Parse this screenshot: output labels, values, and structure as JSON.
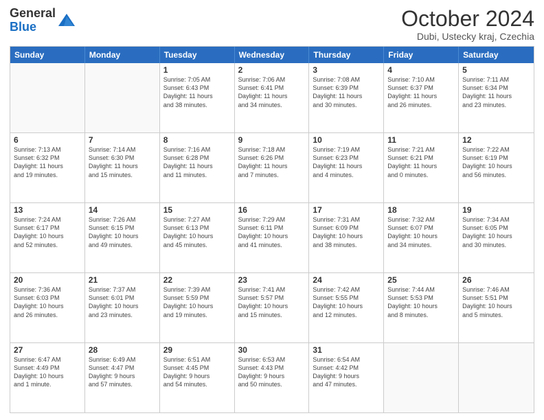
{
  "header": {
    "logo_general": "General",
    "logo_blue": "Blue",
    "month_title": "October 2024",
    "subtitle": "Dubi, Ustecky kraj, Czechia"
  },
  "weekdays": [
    "Sunday",
    "Monday",
    "Tuesday",
    "Wednesday",
    "Thursday",
    "Friday",
    "Saturday"
  ],
  "rows": [
    [
      {
        "day": "",
        "lines": []
      },
      {
        "day": "",
        "lines": []
      },
      {
        "day": "1",
        "lines": [
          "Sunrise: 7:05 AM",
          "Sunset: 6:43 PM",
          "Daylight: 11 hours",
          "and 38 minutes."
        ]
      },
      {
        "day": "2",
        "lines": [
          "Sunrise: 7:06 AM",
          "Sunset: 6:41 PM",
          "Daylight: 11 hours",
          "and 34 minutes."
        ]
      },
      {
        "day": "3",
        "lines": [
          "Sunrise: 7:08 AM",
          "Sunset: 6:39 PM",
          "Daylight: 11 hours",
          "and 30 minutes."
        ]
      },
      {
        "day": "4",
        "lines": [
          "Sunrise: 7:10 AM",
          "Sunset: 6:37 PM",
          "Daylight: 11 hours",
          "and 26 minutes."
        ]
      },
      {
        "day": "5",
        "lines": [
          "Sunrise: 7:11 AM",
          "Sunset: 6:34 PM",
          "Daylight: 11 hours",
          "and 23 minutes."
        ]
      }
    ],
    [
      {
        "day": "6",
        "lines": [
          "Sunrise: 7:13 AM",
          "Sunset: 6:32 PM",
          "Daylight: 11 hours",
          "and 19 minutes."
        ]
      },
      {
        "day": "7",
        "lines": [
          "Sunrise: 7:14 AM",
          "Sunset: 6:30 PM",
          "Daylight: 11 hours",
          "and 15 minutes."
        ]
      },
      {
        "day": "8",
        "lines": [
          "Sunrise: 7:16 AM",
          "Sunset: 6:28 PM",
          "Daylight: 11 hours",
          "and 11 minutes."
        ]
      },
      {
        "day": "9",
        "lines": [
          "Sunrise: 7:18 AM",
          "Sunset: 6:26 PM",
          "Daylight: 11 hours",
          "and 7 minutes."
        ]
      },
      {
        "day": "10",
        "lines": [
          "Sunrise: 7:19 AM",
          "Sunset: 6:23 PM",
          "Daylight: 11 hours",
          "and 4 minutes."
        ]
      },
      {
        "day": "11",
        "lines": [
          "Sunrise: 7:21 AM",
          "Sunset: 6:21 PM",
          "Daylight: 11 hours",
          "and 0 minutes."
        ]
      },
      {
        "day": "12",
        "lines": [
          "Sunrise: 7:22 AM",
          "Sunset: 6:19 PM",
          "Daylight: 10 hours",
          "and 56 minutes."
        ]
      }
    ],
    [
      {
        "day": "13",
        "lines": [
          "Sunrise: 7:24 AM",
          "Sunset: 6:17 PM",
          "Daylight: 10 hours",
          "and 52 minutes."
        ]
      },
      {
        "day": "14",
        "lines": [
          "Sunrise: 7:26 AM",
          "Sunset: 6:15 PM",
          "Daylight: 10 hours",
          "and 49 minutes."
        ]
      },
      {
        "day": "15",
        "lines": [
          "Sunrise: 7:27 AM",
          "Sunset: 6:13 PM",
          "Daylight: 10 hours",
          "and 45 minutes."
        ]
      },
      {
        "day": "16",
        "lines": [
          "Sunrise: 7:29 AM",
          "Sunset: 6:11 PM",
          "Daylight: 10 hours",
          "and 41 minutes."
        ]
      },
      {
        "day": "17",
        "lines": [
          "Sunrise: 7:31 AM",
          "Sunset: 6:09 PM",
          "Daylight: 10 hours",
          "and 38 minutes."
        ]
      },
      {
        "day": "18",
        "lines": [
          "Sunrise: 7:32 AM",
          "Sunset: 6:07 PM",
          "Daylight: 10 hours",
          "and 34 minutes."
        ]
      },
      {
        "day": "19",
        "lines": [
          "Sunrise: 7:34 AM",
          "Sunset: 6:05 PM",
          "Daylight: 10 hours",
          "and 30 minutes."
        ]
      }
    ],
    [
      {
        "day": "20",
        "lines": [
          "Sunrise: 7:36 AM",
          "Sunset: 6:03 PM",
          "Daylight: 10 hours",
          "and 26 minutes."
        ]
      },
      {
        "day": "21",
        "lines": [
          "Sunrise: 7:37 AM",
          "Sunset: 6:01 PM",
          "Daylight: 10 hours",
          "and 23 minutes."
        ]
      },
      {
        "day": "22",
        "lines": [
          "Sunrise: 7:39 AM",
          "Sunset: 5:59 PM",
          "Daylight: 10 hours",
          "and 19 minutes."
        ]
      },
      {
        "day": "23",
        "lines": [
          "Sunrise: 7:41 AM",
          "Sunset: 5:57 PM",
          "Daylight: 10 hours",
          "and 15 minutes."
        ]
      },
      {
        "day": "24",
        "lines": [
          "Sunrise: 7:42 AM",
          "Sunset: 5:55 PM",
          "Daylight: 10 hours",
          "and 12 minutes."
        ]
      },
      {
        "day": "25",
        "lines": [
          "Sunrise: 7:44 AM",
          "Sunset: 5:53 PM",
          "Daylight: 10 hours",
          "and 8 minutes."
        ]
      },
      {
        "day": "26",
        "lines": [
          "Sunrise: 7:46 AM",
          "Sunset: 5:51 PM",
          "Daylight: 10 hours",
          "and 5 minutes."
        ]
      }
    ],
    [
      {
        "day": "27",
        "lines": [
          "Sunrise: 6:47 AM",
          "Sunset: 4:49 PM",
          "Daylight: 10 hours",
          "and 1 minute."
        ]
      },
      {
        "day": "28",
        "lines": [
          "Sunrise: 6:49 AM",
          "Sunset: 4:47 PM",
          "Daylight: 9 hours",
          "and 57 minutes."
        ]
      },
      {
        "day": "29",
        "lines": [
          "Sunrise: 6:51 AM",
          "Sunset: 4:45 PM",
          "Daylight: 9 hours",
          "and 54 minutes."
        ]
      },
      {
        "day": "30",
        "lines": [
          "Sunrise: 6:53 AM",
          "Sunset: 4:43 PM",
          "Daylight: 9 hours",
          "and 50 minutes."
        ]
      },
      {
        "day": "31",
        "lines": [
          "Sunrise: 6:54 AM",
          "Sunset: 4:42 PM",
          "Daylight: 9 hours",
          "and 47 minutes."
        ]
      },
      {
        "day": "",
        "lines": []
      },
      {
        "day": "",
        "lines": []
      }
    ]
  ]
}
